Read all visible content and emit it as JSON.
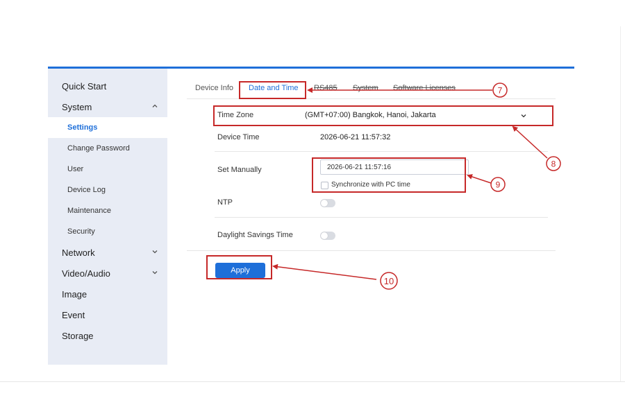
{
  "sidebar": {
    "items": [
      {
        "label": "Quick Start"
      },
      {
        "label": "System"
      },
      {
        "label": "Settings"
      },
      {
        "label": "Change Password"
      },
      {
        "label": "User"
      },
      {
        "label": "Device Log"
      },
      {
        "label": "Maintenance"
      },
      {
        "label": "Security"
      },
      {
        "label": "Network"
      },
      {
        "label": "Video/Audio"
      },
      {
        "label": "Image"
      },
      {
        "label": "Event"
      },
      {
        "label": "Storage"
      }
    ]
  },
  "tabs": [
    {
      "label": "Device Info"
    },
    {
      "label": "Date and Time"
    },
    {
      "label": "RS485"
    },
    {
      "label": "System"
    },
    {
      "label": "Software Licenses"
    }
  ],
  "form": {
    "time_zone_label": "Time Zone",
    "time_zone_value": "(GMT+07:00) Bangkok, Hanoi, Jakarta",
    "device_time_label": "Device Time",
    "device_time_value": "2026-06-21 11:57:32",
    "set_manually_label": "Set Manually",
    "set_manually_value": "2026-06-21 11:57:16",
    "sync_label": "Synchronize with PC time",
    "ntp_label": "NTP",
    "dst_label": "Daylight Savings Time",
    "apply_label": "Apply"
  },
  "callouts": [
    "7",
    "8",
    "9",
    "10"
  ],
  "colors": {
    "accent": "#1e6fd9",
    "annotation": "#c62828",
    "sidebar_bg": "#e8ecf5"
  }
}
